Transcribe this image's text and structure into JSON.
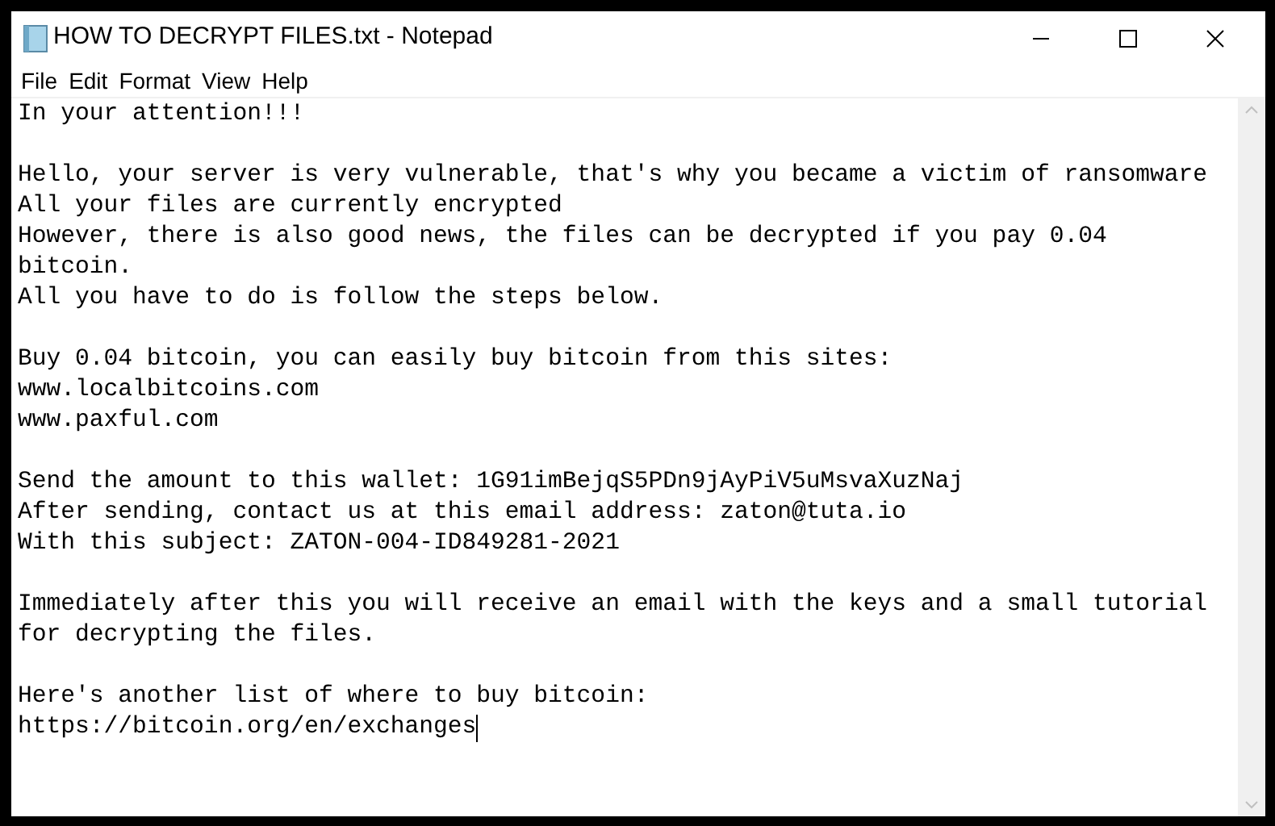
{
  "window": {
    "title": "HOW TO DECRYPT FILES.txt - Notepad"
  },
  "menu": [
    "File",
    "Edit",
    "Format",
    "View",
    "Help"
  ],
  "document": {
    "paragraphs": [
      {
        "lines": [
          "In your attention!!!"
        ]
      },
      {
        "lines": [
          "Hello, your server is very vulnerable, that's why you became a victim of ransomware",
          "All your files are currently encrypted",
          "However, there is also good news, the files can be decrypted if you pay 0.04",
          "bitcoin.",
          "All you have to do is follow the steps below."
        ]
      },
      {
        "lines": [
          "Buy 0.04 bitcoin, you can easily buy bitcoin from this sites:",
          "www.localbitcoins.com",
          "www.paxful.com"
        ]
      },
      {
        "lines": [
          "Send the amount to this wallet: 1G91imBejqS5PDn9jAyPiV5uMsvaXuzNaj",
          "After sending, contact us at this email address: zaton@tuta.io",
          "With this subject: ZATON-004-ID849281-2021"
        ]
      },
      {
        "lines": [
          "Immediately after this you will receive an email with the keys and a small tutorial",
          "for decrypting the files."
        ]
      },
      {
        "lines": [
          "Here's another list of where to buy bitcoin:",
          "https://bitcoin.org/en/exchanges"
        ]
      }
    ]
  }
}
